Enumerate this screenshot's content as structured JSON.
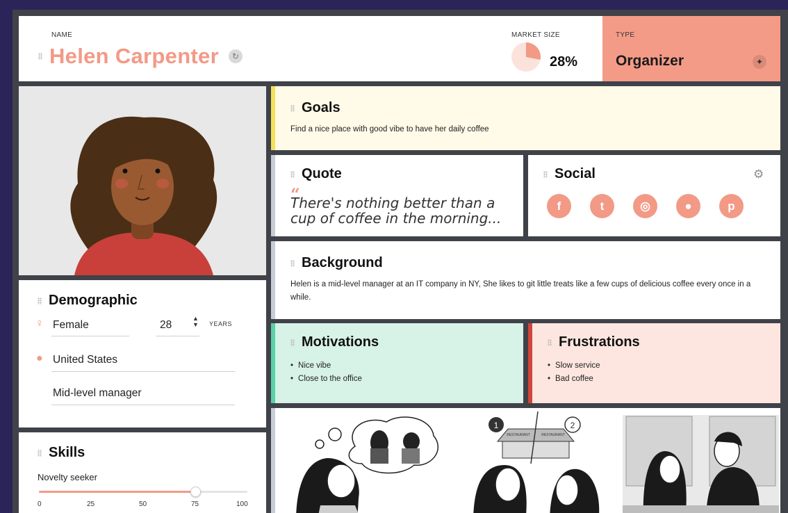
{
  "header": {
    "name_label": "NAME",
    "name": "Helen Carpenter",
    "market_label": "MARKET SIZE",
    "market_value": "28%",
    "market_fraction": 0.28,
    "type_label": "TYPE",
    "type_value": "Organizer"
  },
  "colors": {
    "accent": "#f29a86",
    "type_bg": "#f49b87",
    "goals_bg": "#fffbe8",
    "goals_bar": "#f3e15b",
    "motivations_bg": "#d7f2e7",
    "motivations_bar": "#5bd0a8",
    "frustrations_bg": "#fde6e0",
    "frustrations_bar": "#d0453a"
  },
  "demographic": {
    "title": "Demographic",
    "gender": "Female",
    "age": "28",
    "age_unit": "YEARS",
    "location": "United States",
    "occupation": "Mid-level manager"
  },
  "skills": {
    "title": "Skills",
    "items": [
      {
        "name": "Novelty seeker",
        "value": 75
      }
    ],
    "ticks": [
      "0",
      "25",
      "50",
      "75",
      "100"
    ]
  },
  "goals": {
    "title": "Goals",
    "text": "Find a nice place with good vibe to have her daily coffee"
  },
  "quote": {
    "title": "Quote",
    "mark": "“",
    "text": "There's nothing better than a cup of coffee in the morning..."
  },
  "social": {
    "title": "Social",
    "icons": [
      {
        "name": "facebook-icon",
        "glyph": "f"
      },
      {
        "name": "twitter-icon",
        "glyph": "t"
      },
      {
        "name": "instagram-icon",
        "glyph": "◎"
      },
      {
        "name": "location-icon",
        "glyph": "●"
      },
      {
        "name": "pinterest-icon",
        "glyph": "p"
      }
    ]
  },
  "background": {
    "title": "Background",
    "text": "Helen is a mid-level manager at an IT company in NY, She likes to git little treats like a few cups of delicious coffee every once in a while."
  },
  "motivations": {
    "title": "Motivations",
    "items": [
      "Nice vibe",
      "Close to the office"
    ]
  },
  "frustrations": {
    "title": "Frustrations",
    "items": [
      "Slow service",
      "Bad coffee"
    ]
  },
  "scenes": {
    "sign_left": "RESTAURANT",
    "sign_right": "RESTAURANT",
    "badge_1": "1",
    "badge_2": "2"
  }
}
